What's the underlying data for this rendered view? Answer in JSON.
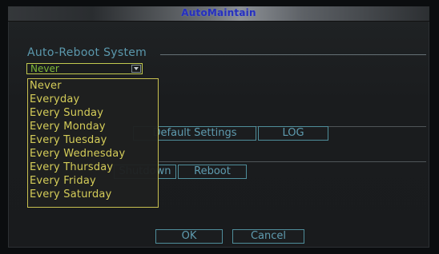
{
  "window": {
    "title": "AutoMaintain"
  },
  "auto_reboot": {
    "label": "Auto-Reboot System",
    "selected": "Never",
    "options": [
      "Never",
      "Everyday",
      "Every Sunday",
      "Every Monday",
      "Every Tuesday",
      "Every Wednesday",
      "Every Thursday",
      "Every Friday",
      "Every Saturday"
    ]
  },
  "buttons": {
    "default_settings": "Default Settings",
    "log": "LOG",
    "shutdown": "Shutdown",
    "reboot": "Reboot",
    "ok": "OK",
    "cancel": "Cancel"
  },
  "colors": {
    "title": "#262fbf",
    "section_label": "#5b98ad",
    "dropdown_text": "#d5cd59",
    "selected_value": "#7fb838",
    "button_text": "#5f9cb0",
    "button_border": "#4f8e9b"
  },
  "icons": {
    "dropdown_arrow": "chevron-down-icon"
  }
}
